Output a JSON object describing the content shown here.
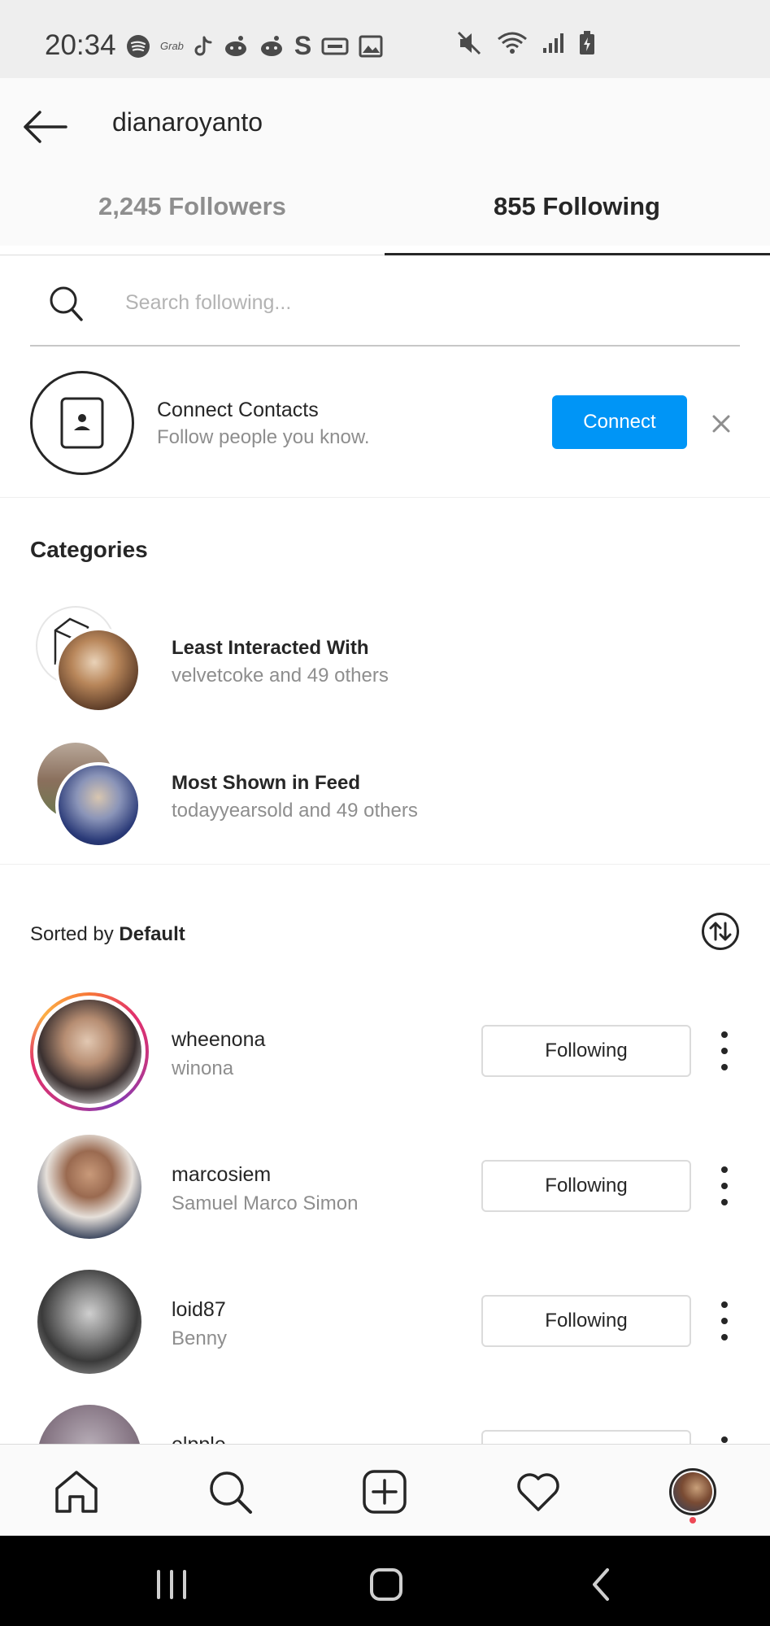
{
  "status_bar": {
    "time": "20:34",
    "left_icons": [
      "spotify-icon",
      "grab-icon",
      "tiktok-icon",
      "reddit-icon",
      "reddit-icon",
      "s-app-icon",
      "voicemail-icon",
      "gallery-icon"
    ],
    "right_icons": [
      "mute-icon",
      "wifi-icon",
      "signal-icon",
      "battery-icon"
    ],
    "grab_text": "Grab"
  },
  "header": {
    "username": "dianaroyanto",
    "tabs": [
      {
        "label": "2,245 Followers",
        "active": false
      },
      {
        "label": "855 Following",
        "active": true
      }
    ]
  },
  "search": {
    "placeholder": "Search following..."
  },
  "connect_contacts": {
    "title": "Connect Contacts",
    "subtitle": "Follow people you know.",
    "button_label": "Connect"
  },
  "categories": {
    "title": "Categories",
    "items": [
      {
        "title": "Least Interacted With",
        "subtitle": "velvetcoke and 49 others"
      },
      {
        "title": "Most Shown in Feed",
        "subtitle": "todayyearsold and 49 others"
      }
    ]
  },
  "sort": {
    "prefix": "Sorted by",
    "value": "Default"
  },
  "users": [
    {
      "username": "wheenona",
      "full_name": "winona",
      "button": "Following",
      "has_story": true
    },
    {
      "username": "marcosiem",
      "full_name": "Samuel Marco Simon",
      "button": "Following",
      "has_story": false
    },
    {
      "username": "loid87",
      "full_name": "Benny",
      "button": "Following",
      "has_story": false
    },
    {
      "username": "elpple",
      "full_name": "",
      "button": "",
      "has_story": false
    }
  ],
  "bottom_nav": [
    "home-icon",
    "search-icon",
    "new-post-icon",
    "activity-icon",
    "profile-avatar"
  ],
  "colors": {
    "accent": "#0095f6",
    "text_primary": "#262626",
    "text_secondary": "#8e8e8e",
    "notification": "#ed4956"
  }
}
